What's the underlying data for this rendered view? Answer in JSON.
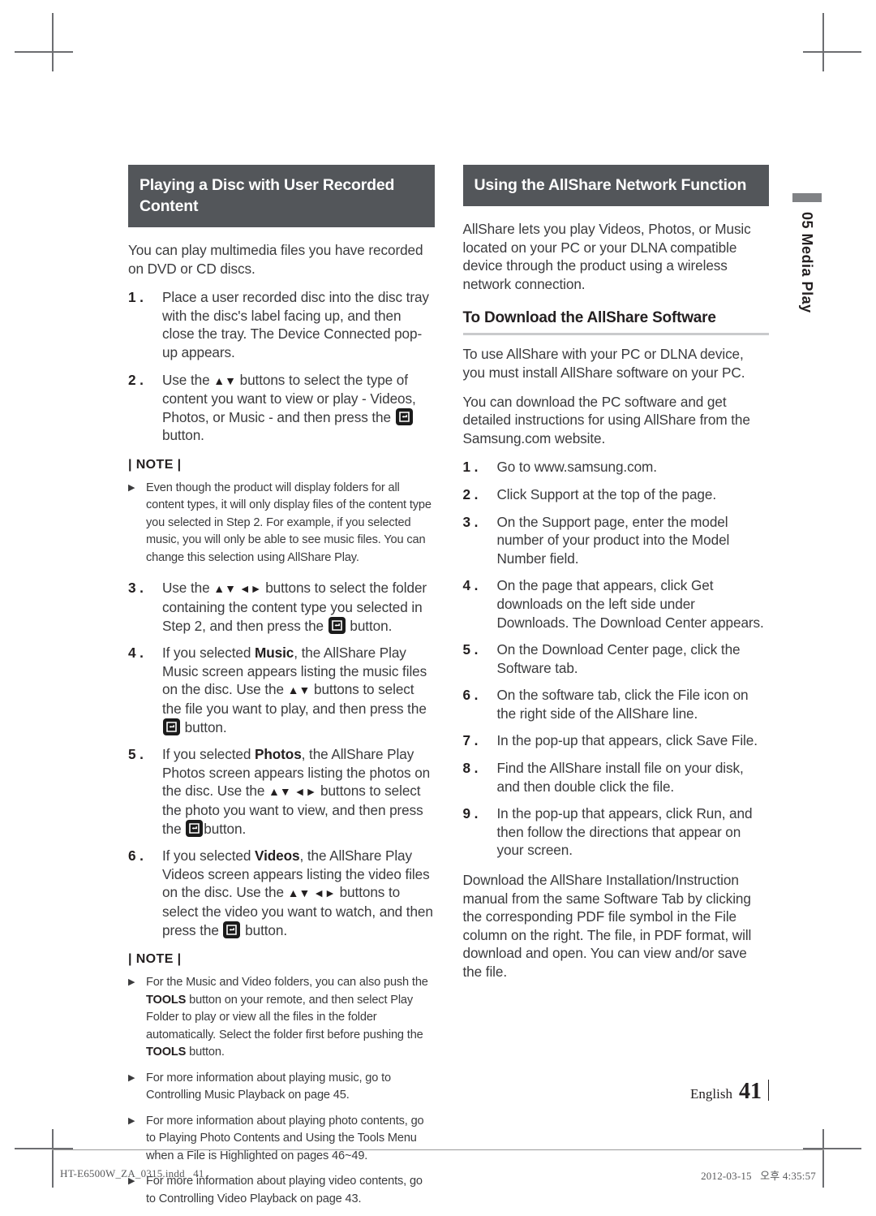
{
  "left_column": {
    "section_title": "Playing a Disc with User Recorded Content",
    "intro": "You can play multimedia files you have recorded on DVD or CD discs.",
    "steps": [
      {
        "num": "1 .",
        "text_a": "Place a user recorded disc into the disc tray with the disc's label facing up, and then close the tray. The Device Connected pop-up appears.",
        "text_b": "",
        "arrows": "",
        "arrows2": "",
        "icon": "none"
      },
      {
        "num": "2 .",
        "text_a": "Use the ",
        "arrows": "▲▼",
        "text_b": " buttons to select the type of content you want to view or play - Videos, Photos, or Music - and then press the ",
        "icon": "enter-button-icon",
        "text_c": " button."
      },
      {
        "num": "3 .",
        "text_a": "Use the ",
        "arrows": "▲▼ ◄►",
        "text_b": " buttons to select the folder containing the content type you selected in Step 2, and then press the ",
        "icon": "enter-button-icon",
        "text_c": " button."
      },
      {
        "num": "4 .",
        "text_a": "If you selected ",
        "bold": "Music",
        "text_b": ", the AllShare Play Music screen appears listing the music files on the disc. Use the ",
        "arrows": "▲▼",
        "text_c": " buttons to select the file you want to play, and then press the ",
        "icon": "enter-button-icon",
        "text_d": " button."
      },
      {
        "num": "5 .",
        "text_a": "If you selected ",
        "bold": "Photos",
        "text_b": ", the AllShare Play Photos screen appears listing the photos on the disc. Use the ",
        "arrows": "▲▼ ◄►",
        "text_c": " buttons to select the photo you want to view, and then press the ",
        "icon": "enter-button-icon",
        "text_d": "button."
      },
      {
        "num": "6 .",
        "text_a": "If you selected ",
        "bold": "Videos",
        "text_b": ", the AllShare Play Videos screen appears listing the video files on the disc. Use the ",
        "arrows": "▲▼ ◄►",
        "text_c": " buttons to select the video you want to watch, and then press the ",
        "icon": "enter-button-icon",
        "text_d": " button."
      }
    ],
    "note_label_1": "| NOTE |",
    "notes_1": [
      "Even though the product will display folders for all content types, it will only display files of the content type you selected in Step 2. For example, if you selected music, you will only be able to see music files. You can change this selection using AllShare Play."
    ],
    "note_label_2": "| NOTE |",
    "notes_2": [
      {
        "part_a": "For the Music and Video folders, you can also push the ",
        "bold_1": "TOOLS",
        "part_b": " button on your remote, and then select Play Folder to play or view all the files in the folder automatically. Select the folder first before pushing the ",
        "bold_2": "TOOLS",
        "part_c": " button."
      },
      {
        "part_a": "For more information about playing music, go to Controlling Music Playback on page 45."
      },
      {
        "part_a": "For more information about playing photo contents, go to Playing Photo Contents and Using the Tools Menu when a File is Highlighted on pages 46~49."
      },
      {
        "part_a": "For more information about playing video contents, go to Controlling Video Playback on page 43."
      }
    ]
  },
  "right_column": {
    "section_title": "Using the AllShare Network Function",
    "intro": "AllShare lets you play Videos, Photos, or Music located on your PC or your DLNA compatible device through the product using a wireless network connection.",
    "sub_heading": "To Download the AllShare Software",
    "para_1": "To use AllShare with your PC or DLNA device, you must install AllShare software on your PC.",
    "para_2": "You can download the PC software and get detailed instructions for using AllShare from the Samsung.com website.",
    "steps": [
      {
        "num": "1 .",
        "text": "Go to www.samsung.com."
      },
      {
        "num": "2 .",
        "text": "Click Support at the top of the page."
      },
      {
        "num": "3 .",
        "text": "On the Support page, enter the model number of your product into the Model Number field."
      },
      {
        "num": "4 .",
        "text": "On the page that appears, click Get downloads on the left side under Downloads. The Download Center appears."
      },
      {
        "num": "5 .",
        "text": "On the Download Center page, click the Software tab."
      },
      {
        "num": "6 .",
        "text": "On the software tab, click the File icon on the right side of the AllShare line."
      },
      {
        "num": "7 .",
        "text": "In the pop-up that appears, click Save File."
      },
      {
        "num": "8 .",
        "text": "Find the AllShare install file on your disk, and then double click the file."
      },
      {
        "num": "9 .",
        "text": "In the pop-up that appears, click Run, and then follow the directions that appear on your screen."
      }
    ],
    "closing": "Download the AllShare Installation/Instruction manual from the same Software Tab by clicking the corresponding PDF file symbol in the File column on the right. The file, in PDF format, will download and open. You can view and/or save the file."
  },
  "side_tab": {
    "chapter_number": "05",
    "chapter_label": "Media Play"
  },
  "page_footer": {
    "language": "English",
    "page_number": "41"
  },
  "print_footer": {
    "file_name": "HT-E6500W_ZA_0315.indd   41",
    "timestamp": "2012-03-15   오후 4:35:57"
  },
  "colors": {
    "section_bar_bg": "#53565a",
    "text": "#3b3b3d",
    "heading": "#231f20",
    "rule": "#c9cacc",
    "side_bar": "#808285"
  }
}
